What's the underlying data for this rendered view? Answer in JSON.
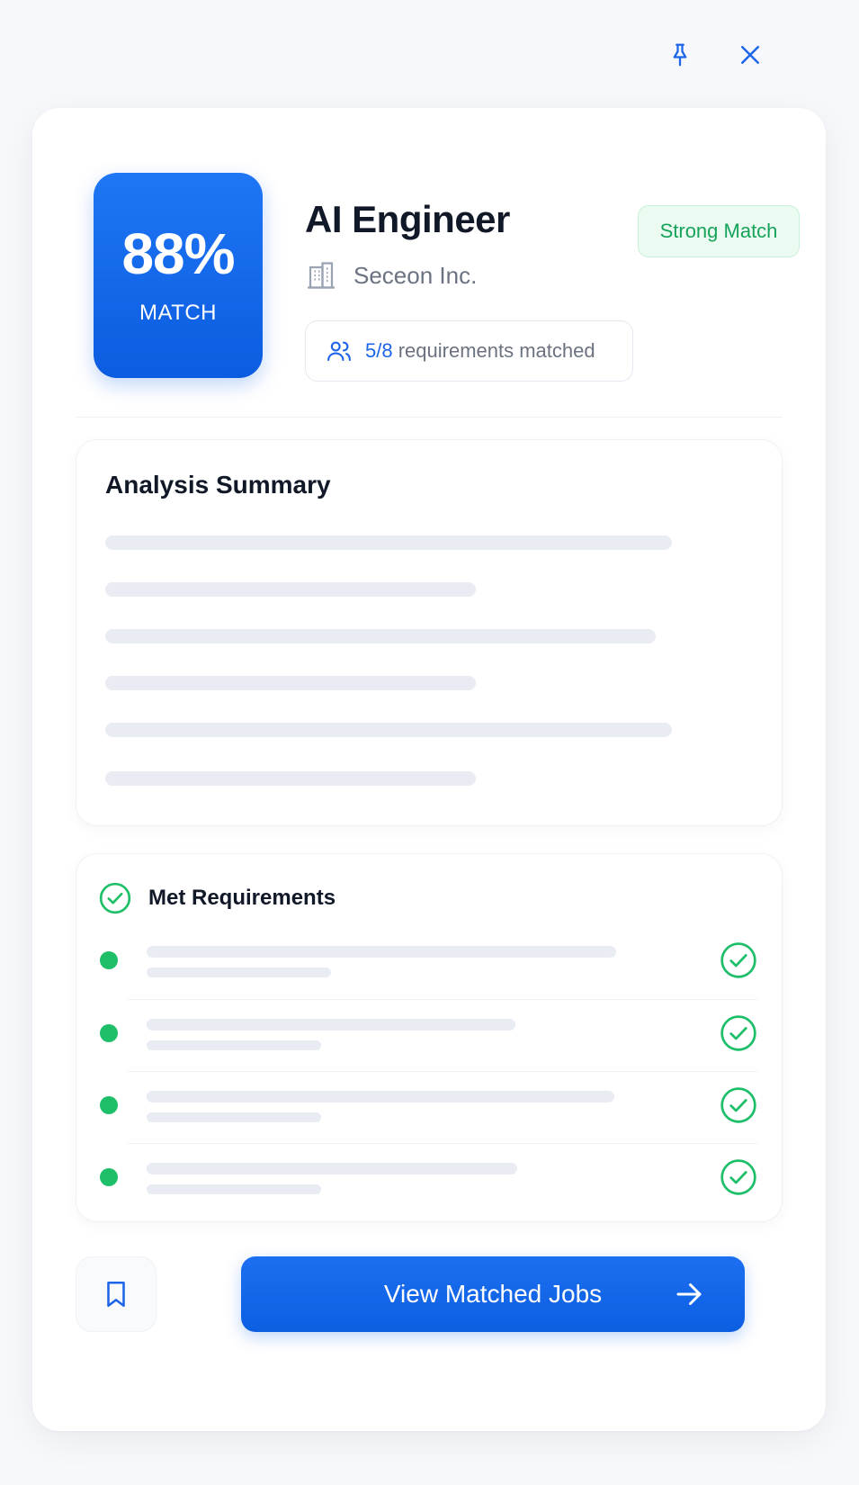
{
  "window": {
    "pin_icon": "pin-icon",
    "close_icon": "close-icon"
  },
  "header": {
    "score_value": "88%",
    "score_label": "MATCH",
    "job_title": "AI Engineer",
    "company_icon": "building-icon",
    "company_name": "Seceon Inc.",
    "match_badge": "Strong Match",
    "requirements_icon": "users-icon",
    "requirements_count": "5/8",
    "requirements_text": "requirements matched"
  },
  "analysis": {
    "title": "Analysis Summary",
    "lines_loading": 6
  },
  "met_requirements": {
    "title": "Met Requirements",
    "icon": "check-circle-icon",
    "items_loading": 4
  },
  "footer": {
    "bookmark_icon": "bookmark-icon",
    "primary_label": "View Matched Jobs",
    "primary_icon": "arrow-right-icon"
  },
  "colors": {
    "primary": "#1565e6",
    "success": "#1fbf6a",
    "badge_bg": "#ecfbf2",
    "muted": "#6b7280"
  }
}
